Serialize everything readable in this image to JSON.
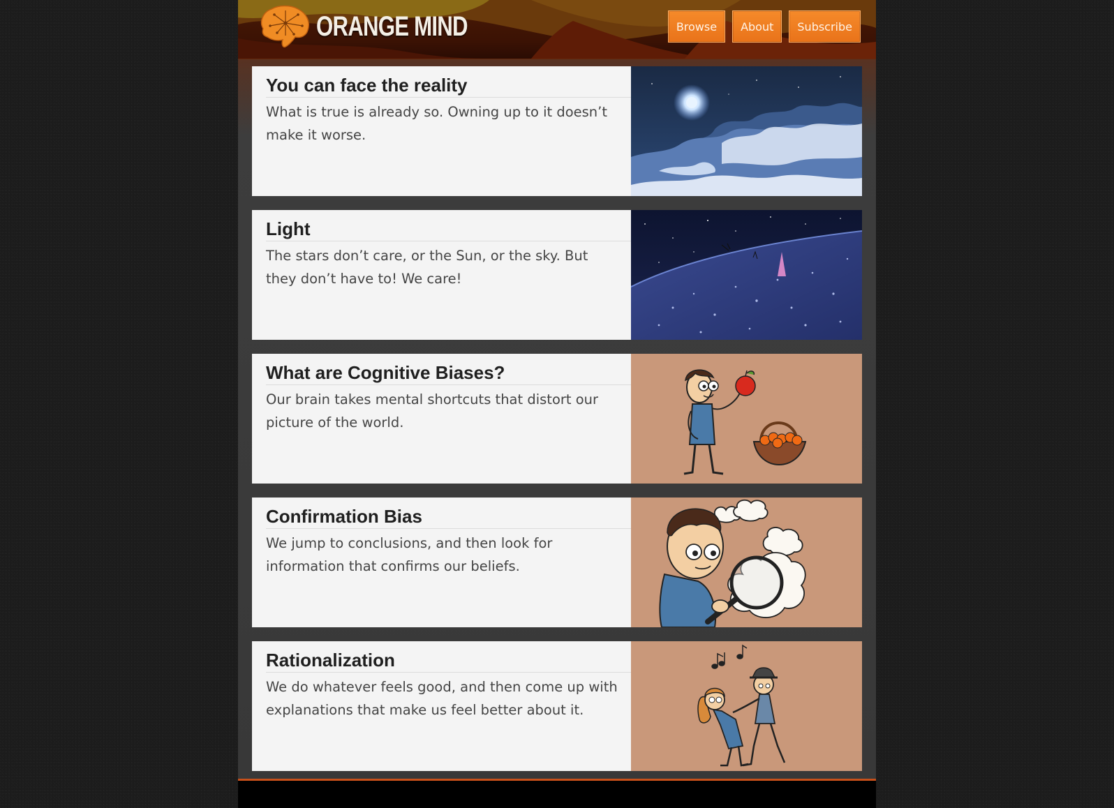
{
  "site": {
    "logo_text": "ORANGE MIND"
  },
  "nav": {
    "items": [
      {
        "label": "Browse"
      },
      {
        "label": "About"
      },
      {
        "label": "Subscribe"
      }
    ]
  },
  "articles": [
    {
      "title": "You can face the reality",
      "description": "What is true is already so. Owning up to it doesn’t make it worse."
    },
    {
      "title": "Light",
      "description": "The stars don’t care, or the Sun, or the sky. But they don’t have to! We care!"
    },
    {
      "title": "What are Cognitive Biases?",
      "description": "Our brain takes mental shortcuts that distort our picture of the world."
    },
    {
      "title": "Confirmation Bias",
      "description": "We jump to conclusions, and then look for information that confirms our beliefs."
    },
    {
      "title": "Rationalization",
      "description": "We do whatever feels good, and then come up with explanations that make us feel better about it."
    }
  ],
  "colors": {
    "accent": "#f07d22",
    "header_bg": "#3b1204",
    "card_bg": "#f4f4f4",
    "footer_line": "#c8501a"
  }
}
